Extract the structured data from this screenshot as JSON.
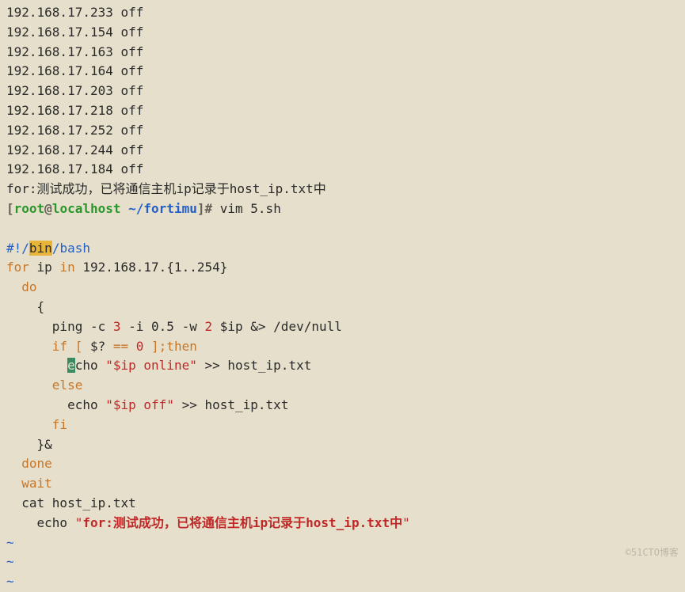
{
  "output": [
    {
      "ip": "192.168.17.233",
      "status": "off"
    },
    {
      "ip": "192.168.17.154",
      "status": "off"
    },
    {
      "ip": "192.168.17.163",
      "status": "off"
    },
    {
      "ip": "192.168.17.164",
      "status": "off"
    },
    {
      "ip": "192.168.17.203",
      "status": "off"
    },
    {
      "ip": "192.168.17.218",
      "status": "off"
    },
    {
      "ip": "192.168.17.252",
      "status": "off"
    },
    {
      "ip": "192.168.17.244",
      "status": "off"
    },
    {
      "ip": "192.168.17.184",
      "status": "off"
    }
  ],
  "result_msg": "for:测试成功，已将通信主机ip记录于host_ip.txt中",
  "prompt": {
    "open": "[",
    "user": "root",
    "at": "@",
    "host": "localhost",
    "path": " ~/fortimu",
    "close": "]",
    "hash": "#",
    "command": " vim 5.sh"
  },
  "script": {
    "shebang_pre": "#!/",
    "shebang_hl": "bin",
    "shebang_post": "/bash",
    "for_kw": "for",
    "ip_var": " ip ",
    "in_kw": "in",
    "range": " 192.168.17.{1..254}",
    "do_kw": "  do",
    "brace_open": "    {",
    "ping_pre": "      ping -c ",
    "num3": "3",
    "ping_mid1": " -i 0.5 -w ",
    "num2": "2",
    "ping_post": " $ip &> /dev/null",
    "if_kw": "      if",
    "if_cond_open": " [ ",
    "dollarq": "$?",
    "eq": " == ",
    "zero": "0",
    "if_cond_close": " ];",
    "then_kw": "then",
    "echo_cur": "e",
    "echo_rest1": "cho ",
    "str_open1": "\"",
    "str_ip1": "$ip ",
    "str_online": "online",
    "str_close1": "\"",
    "redir1": " >> host_ip.txt",
    "else_kw": "      else",
    "echo2_pre": "        echo ",
    "str_open2": "\"",
    "str_ip2": "$ip ",
    "str_off": "off",
    "str_close2": "\"",
    "redir2": " >> host_ip.txt",
    "fi_kw": "      fi",
    "brace_close": "    }&",
    "done_kw": "  done",
    "wait_kw": "  wait",
    "cat_line": "  cat host_ip.txt",
    "final_echo_pre": "    echo ",
    "final_echo_q1": "\"",
    "final_echo_body": "for:测试成功，已将通信主机ip记录于host_ip.txt中",
    "final_echo_q2": "\""
  },
  "tilde": "~",
  "watermark": "©51CTO博客"
}
